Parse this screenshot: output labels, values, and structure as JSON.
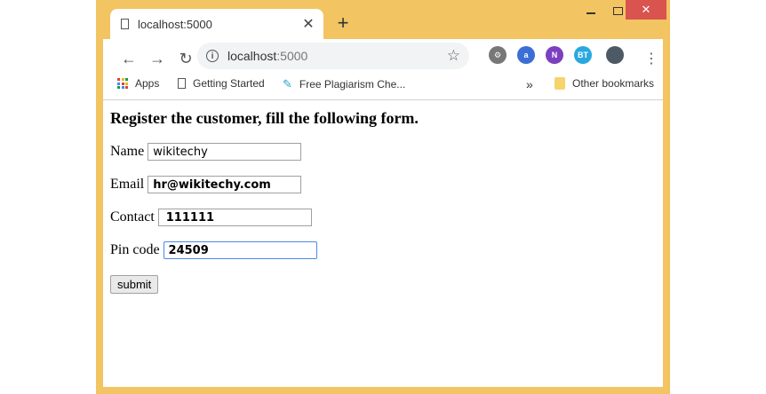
{
  "window": {
    "close_glyph": "✕"
  },
  "tab": {
    "title": "localhost:5000",
    "close_glyph": "✕",
    "new_tab_glyph": "+"
  },
  "toolbar": {
    "back_glyph": "←",
    "forward_glyph": "→",
    "reload_glyph": "↻",
    "url_host": "localhost",
    "url_port": ":5000",
    "star_glyph": "☆",
    "menu_glyph": "⋮"
  },
  "extensions": [
    {
      "name": "gear-extension",
      "label": "⚙",
      "color": "#777777"
    },
    {
      "name": "download-extension",
      "label": "a",
      "color": "#3b6fd6"
    },
    {
      "name": "onenote-extension",
      "label": "N",
      "color": "#7b3fbf"
    },
    {
      "name": "bt-extension",
      "label": "BT",
      "color": "#29a8e0"
    },
    {
      "name": "profile-avatar",
      "label": "",
      "color": "#4d5a66"
    }
  ],
  "bookmarks": {
    "apps": "Apps",
    "getting_started": "Getting Started",
    "plagiarism": "Free Plagiarism Che...",
    "overflow": "»",
    "other": "Other bookmarks"
  },
  "form": {
    "heading": "Register the customer, fill the following form.",
    "name_label": "Name",
    "name_value": "wikitechy",
    "email_label": "Email",
    "email_value": "hr@wikitechy.com",
    "contact_label": "Contact",
    "contact_value": "111111",
    "pin_label": "Pin code",
    "pin_value": "24509",
    "submit_label": "submit"
  }
}
